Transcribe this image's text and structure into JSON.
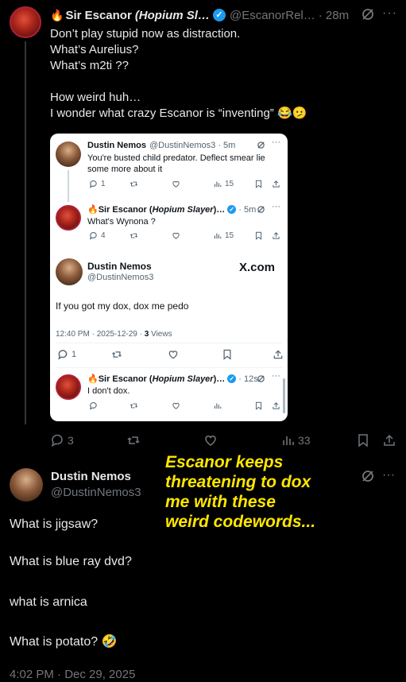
{
  "main_tweet": {
    "name_prefix": "🔥",
    "name": "Sir Escanor",
    "name_suffix": "(Hopium Sl…",
    "handle": "@EscanorRel…",
    "time": "· 28m",
    "lines": [
      "Don’t play stupid now as distraction.",
      "What’s Aurelius?",
      "What’s m2ti ??",
      "",
      "How weird huh…",
      "I wonder what crazy Escanor is “inventing” 😂🫤"
    ],
    "actions": {
      "replies": "3",
      "views": "33"
    }
  },
  "card": {
    "t1": {
      "name": "Dustin Nemos",
      "handle": "@DustinNemos3 · 5m",
      "text": "You're busted child predator. Deflect smear lie some more about it",
      "replies": "1",
      "views": "15"
    },
    "t2": {
      "name": "🔥Sir Escanor (",
      "name_italic": "Hopium Slayer",
      "name_end": ")…",
      "time": "· 5m",
      "text": "What's Wynona ?",
      "replies": "4",
      "views": "15"
    },
    "t3": {
      "name": "Dustin Nemos",
      "handle": "@DustinNemos3",
      "badge": "X.com",
      "text": "If you got my dox, dox me pedo",
      "meta_time": "12:40 PM · 2025-12-29 · ",
      "meta_views_num": "3",
      "meta_views_label": " Views",
      "replies": "1"
    },
    "t4": {
      "name": "🔥Sir Escanor (",
      "name_italic": "Hopium Slayer",
      "name_end": ")…",
      "time": "· 12s",
      "text": "I don't dox."
    }
  },
  "reply_tweet": {
    "name": "Dustin Nemos",
    "handle": "@DustinNemos3",
    "lines": [
      "What is jigsaw?",
      "What is blue ray dvd?",
      "what is arnica",
      "What is potato? 🤣"
    ],
    "timestamp": "4:02 PM · Dec 29, 2025"
  },
  "overlay": {
    "caption_lines": [
      "Escanor keeps",
      "threatening to dox",
      "me with these",
      "weird codewords..."
    ]
  },
  "colors": {
    "background": "#000000",
    "text": "#e7e9ea",
    "secondary": "#71767b",
    "verified": "#1d9bf0",
    "caption": "#ffe600"
  }
}
